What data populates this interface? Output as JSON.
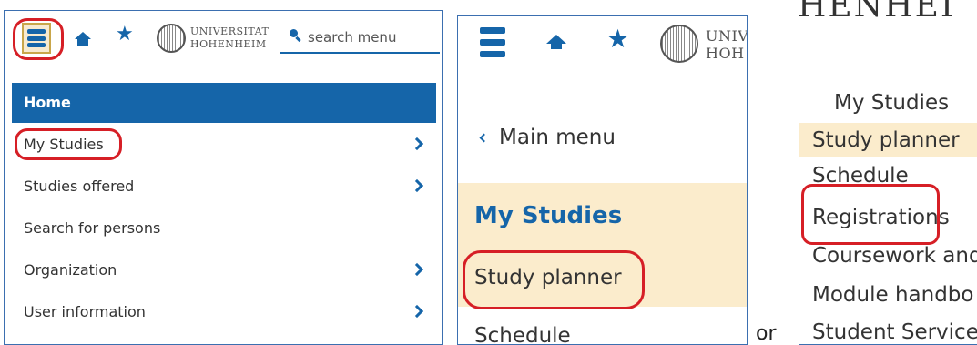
{
  "panel1": {
    "university": {
      "line1": "UNIVERSITAT",
      "line2": "HOHENHEIM"
    },
    "search": {
      "placeholder": "search menu"
    },
    "home_label": "Home",
    "menu_items": [
      {
        "label": "My Studies",
        "has_submenu": true
      },
      {
        "label": "Studies offered",
        "has_submenu": true
      },
      {
        "label": "Search for persons",
        "has_submenu": false
      },
      {
        "label": "Organization",
        "has_submenu": true
      },
      {
        "label": "User information",
        "has_submenu": true
      }
    ]
  },
  "panel2": {
    "university": {
      "line1": "UNIV",
      "line2": "HOH"
    },
    "back_label": "Main menu",
    "section_title": "My Studies",
    "highlighted_item": "Study planner",
    "next_item": "Schedule"
  },
  "separator": "or",
  "panel3": {
    "header_fragment": "HENHEI",
    "section_title": "My Studies",
    "items": [
      "Study planner",
      "Schedule",
      "Registrations",
      "Coursework and",
      "Module handbo",
      "Student Services"
    ]
  },
  "colors": {
    "primary": "#1565a9",
    "highlight_bg": "#fbeccc",
    "annotation": "#d61f26"
  },
  "icons": [
    "hamburger-menu-icon",
    "home-icon",
    "star-icon",
    "university-seal-icon",
    "search-icon",
    "chevron-right-icon",
    "chevron-left-icon"
  ]
}
